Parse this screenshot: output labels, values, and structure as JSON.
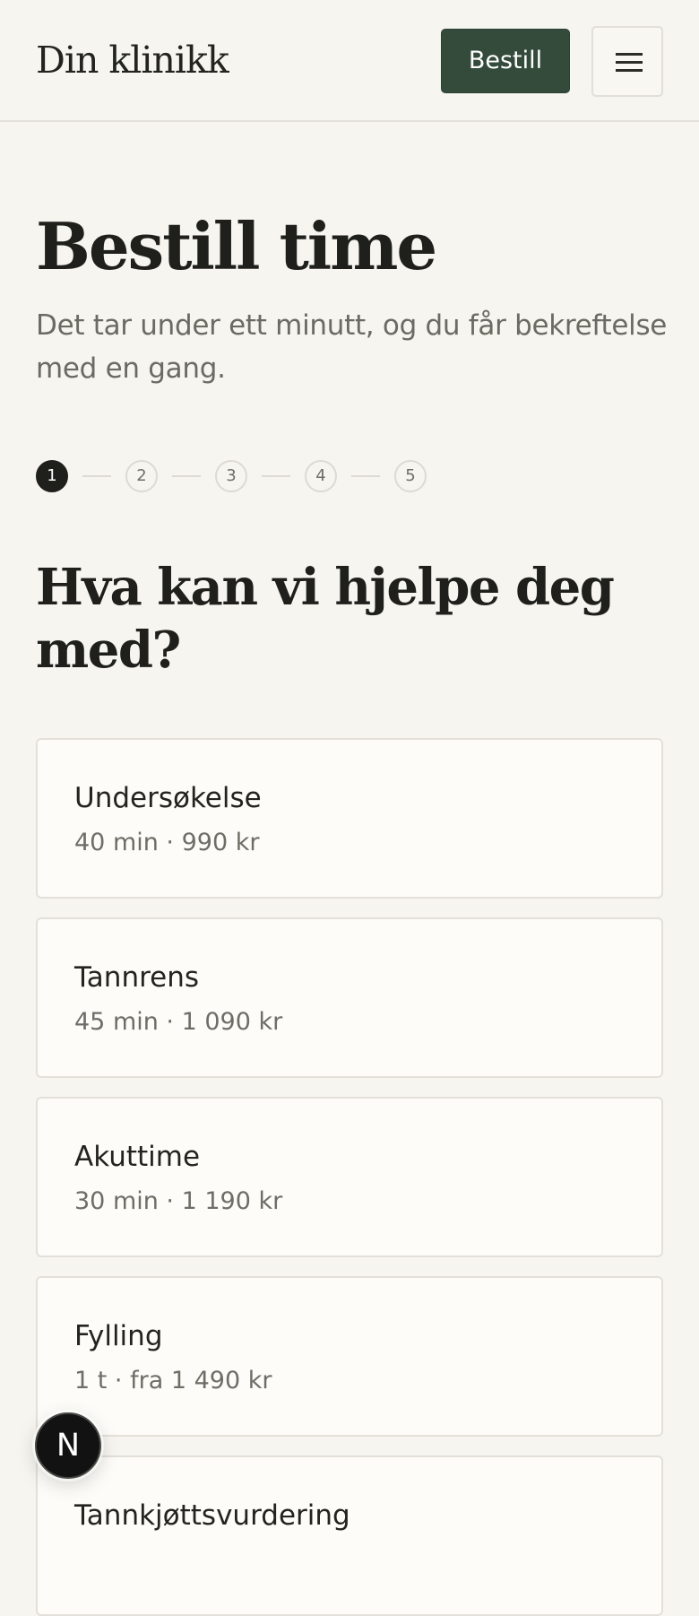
{
  "header": {
    "brand": "Din klinikk",
    "book_label": "Bestill",
    "menu_icon": "hamburger-menu-icon"
  },
  "hero": {
    "title": "Bestill time",
    "intro": "Det tar under ett minutt, og du får bekreftelse med en gang."
  },
  "stepper": {
    "current": 1,
    "steps": [
      "1",
      "2",
      "3",
      "4",
      "5"
    ]
  },
  "question": "Hva kan vi hjelpe deg med?",
  "services": [
    {
      "name": "Undersøkelse",
      "meta": "40 min · 990 kr"
    },
    {
      "name": "Tannrens",
      "meta": "45 min · 1 090 kr"
    },
    {
      "name": "Akuttime",
      "meta": "30 min · 1 190 kr"
    },
    {
      "name": "Fylling",
      "meta": "1 t · fra 1 490 kr"
    },
    {
      "name": "Tannkjøttsvurdering",
      "meta": ""
    }
  ],
  "dev_badge": {
    "label": "N",
    "icon": "nextjs-dev-indicator-icon"
  },
  "colors": {
    "background": "#f6f5f0",
    "accent": "#344b3c",
    "card": "#fdfcf8",
    "border": "#e2e0d8",
    "muted_text": "#6b6a63"
  }
}
